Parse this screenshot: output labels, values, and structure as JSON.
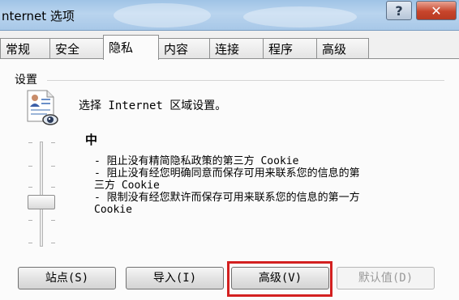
{
  "window": {
    "title": "nternet 选项",
    "help_label": "?",
    "close_label": "✕"
  },
  "tabs": [
    {
      "label": "常规"
    },
    {
      "label": "安全"
    },
    {
      "label": "隐私",
      "active": true
    },
    {
      "label": "内容"
    },
    {
      "label": "连接"
    },
    {
      "label": "程序"
    },
    {
      "label": "高级"
    }
  ],
  "settings": {
    "group_label": "设置",
    "zone_text": "选择 Internet 区域设置。",
    "level": "中",
    "description_lines": [
      "- 阻止没有精简隐私政策的第三方 Cookie",
      "- 阻止没有经您明确同意而保存可用来联系您的信息的第",
      "三方 Cookie",
      "- 限制没有经您默许而保存可用来联系您的信息的第一方",
      "Cookie"
    ],
    "slider_level_fraction": 0.5
  },
  "buttons": {
    "sites": "站点(S)",
    "import": "导入(I)",
    "advanced": "高级(V)",
    "default": "默认值(D)"
  },
  "colors": {
    "highlight": "#d32020",
    "titlebar": "#b9d4ee"
  }
}
